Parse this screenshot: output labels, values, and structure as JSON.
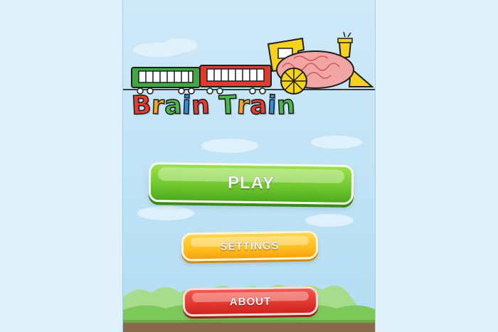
{
  "game": {
    "title_letters": [
      {
        "ch": "B",
        "color": "#e53b31"
      },
      {
        "ch": "r",
        "color": "#f6a61c"
      },
      {
        "ch": "a",
        "color": "#4bb64a"
      },
      {
        "ch": "i",
        "color": "#2f8fd8"
      },
      {
        "ch": "n",
        "color": "#e53b31"
      },
      {
        "ch": " ",
        "color": "#000000"
      },
      {
        "ch": "T",
        "color": "#4bb64a"
      },
      {
        "ch": "r",
        "color": "#f6a61c"
      },
      {
        "ch": "a",
        "color": "#e53b31"
      },
      {
        "ch": "i",
        "color": "#2f8fd8"
      },
      {
        "ch": "n",
        "color": "#4bb64a"
      }
    ]
  },
  "menu": {
    "play_label": "PLAY",
    "settings_label": "SETTINGS",
    "about_label": "ABOUT"
  },
  "colors": {
    "sky": "#c7e6f7",
    "play": "#6fc62e",
    "settings": "#ffbe1f",
    "about": "#e2352e",
    "grass": "#7cc95a"
  },
  "icons": {
    "logo": "train-with-brain-icon"
  }
}
